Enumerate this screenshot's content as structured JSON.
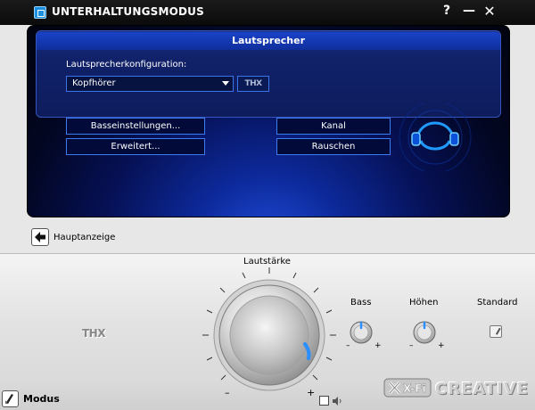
{
  "window": {
    "title": "UNTERHALTUNGSMODUS",
    "help_label": "?",
    "minimize_label": "—",
    "close_label": "✕"
  },
  "speaker_panel": {
    "section_title": "Lautsprecher",
    "config_label": "Lautsprecherkonfiguration:",
    "config_value": "Kopfhörer",
    "thx_button_label": "THX",
    "buttons": {
      "bass_settings": "Basseinstellungen...",
      "advanced": "Erweitert...",
      "channel": "Kanal",
      "noise": "Rauschen"
    }
  },
  "navigation": {
    "back_label": "Hauptanzeige"
  },
  "console": {
    "volume_label": "Lautstärke",
    "volume_minus": "–",
    "volume_plus": "+",
    "bass_label": "Bass",
    "treble_label": "Höhen",
    "standard_label": "Standard",
    "knob_minus": "–",
    "knob_plus": "+",
    "thx_logo": "THX",
    "mode_label": "Modus",
    "brand_logo": "CREATIVE",
    "xfi_logo": "X-Fi"
  },
  "colors": {
    "panel_accent": "#3b7cf0",
    "indicator_blue": "#2a8fff"
  }
}
